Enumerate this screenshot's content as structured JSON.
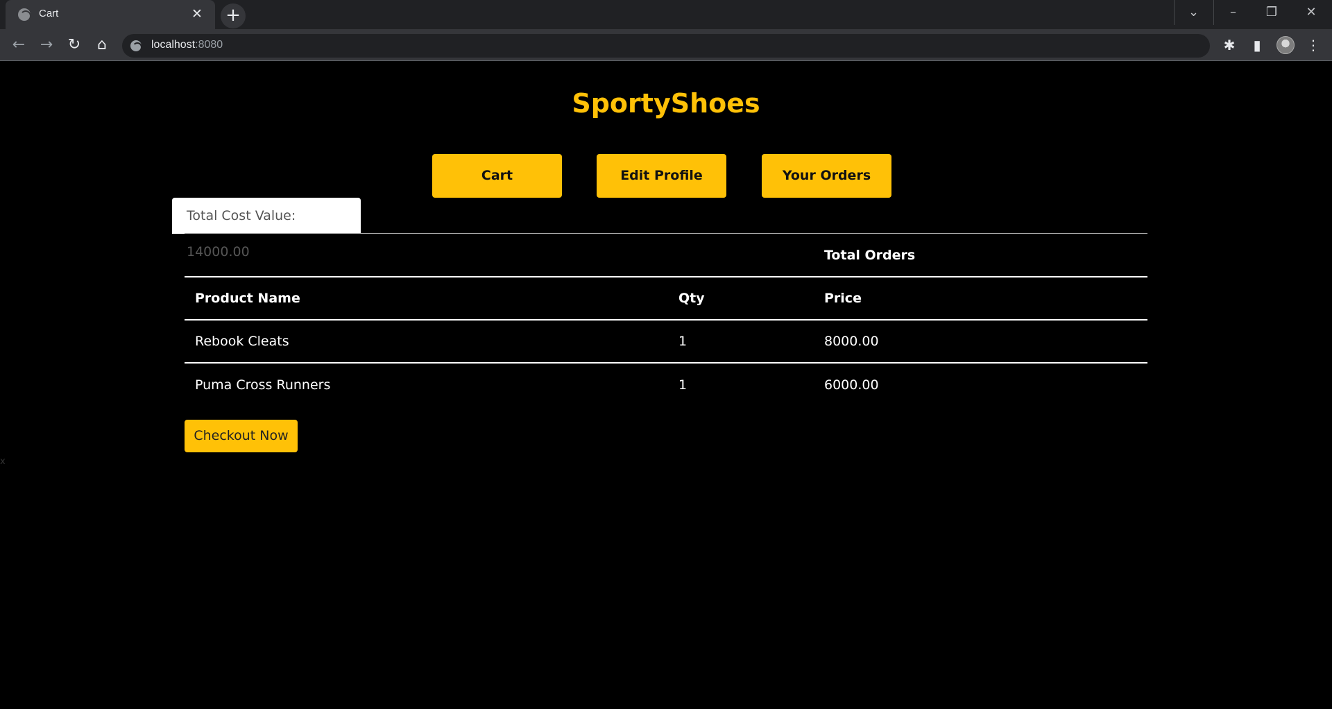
{
  "browser": {
    "tab_title": "Cart",
    "url_host": "localhost",
    "url_port": ":8080"
  },
  "icons": {
    "tab_favicon": "globe-icon",
    "tab_close": "close-icon",
    "new_tab": "plus-icon",
    "back": "back-arrow-icon",
    "forward": "forward-arrow-icon",
    "reload": "reload-icon",
    "home": "home-icon",
    "site_info": "globe-icon",
    "extensions": "puzzle-icon",
    "side_panel": "side-panel-icon",
    "menu": "kebab-menu-icon"
  },
  "colors": {
    "accent": "#ffc107",
    "background": "#000000",
    "text": "#ffffff"
  },
  "brand": "SportyShoes",
  "nav": {
    "cart": "Cart",
    "edit_profile": "Edit Profile",
    "your_orders": "Your Orders"
  },
  "summary": {
    "total_cost": "Total Cost Value: 14000.00"
  },
  "table": {
    "caption": "Total Orders",
    "headers": [
      "Product Name",
      "Qty",
      "Price"
    ],
    "rows": [
      {
        "name": "Rebook Cleats",
        "qty": "1",
        "price": "8000.00"
      },
      {
        "name": "Puma Cross Runners",
        "qty": "1",
        "price": "6000.00"
      }
    ]
  },
  "checkout_label": "Checkout Now",
  "stray_text": "x"
}
